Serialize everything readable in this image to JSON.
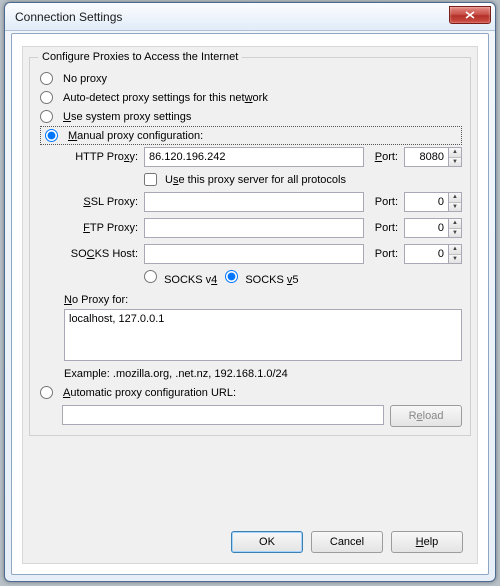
{
  "window": {
    "title": "Connection Settings"
  },
  "group": {
    "legend": "Configure Proxies to Access the Internet"
  },
  "radios": {
    "no_proxy": "No proxy",
    "autodetect_pre": "Auto-detect proxy settings for this net",
    "autodetect_u": "w",
    "autodetect_post": "ork",
    "system_u": "U",
    "system_post": "se system proxy settings",
    "manual_u": "M",
    "manual_post": "anual proxy configuration:",
    "autourl_u": "A",
    "autourl_post": "utomatic proxy configuration URL:"
  },
  "labels": {
    "http_pre": "HTTP Pro",
    "http_u": "x",
    "http_post": "y:",
    "port_u": "P",
    "port_post": "ort:",
    "port_plain": "Port:",
    "useforall_pre": "U",
    "useforall_u": "s",
    "useforall_post": "e this proxy server for all protocols",
    "ssl_u": "S",
    "ssl_post": "SL Proxy:",
    "ftp_u": "F",
    "ftp_post": "TP Proxy:",
    "socks_pre": "SO",
    "socks_u": "C",
    "socks_post": "KS Host:",
    "socks4_pre": "SOCKS v",
    "socks4_u": "4",
    "socks5_pre": "SOCKS ",
    "socks5_u": "v",
    "socks5_post": "5",
    "noproxy_u": "N",
    "noproxy_post": "o Proxy for:",
    "example": "Example: .mozilla.org, .net.nz, 192.168.1.0/24",
    "reload_u": "e",
    "reload_pre": "R",
    "reload_post": "load"
  },
  "values": {
    "http_host": "86.120.196.242",
    "http_port": "8080",
    "ssl_host": "",
    "ssl_port": "0",
    "ftp_host": "",
    "ftp_port": "0",
    "socks_host": "",
    "socks_port": "0",
    "noproxy": "localhost, 127.0.0.1",
    "auto_url": ""
  },
  "buttons": {
    "ok": "OK",
    "cancel": "Cancel",
    "help_u": "H",
    "help_post": "elp"
  }
}
